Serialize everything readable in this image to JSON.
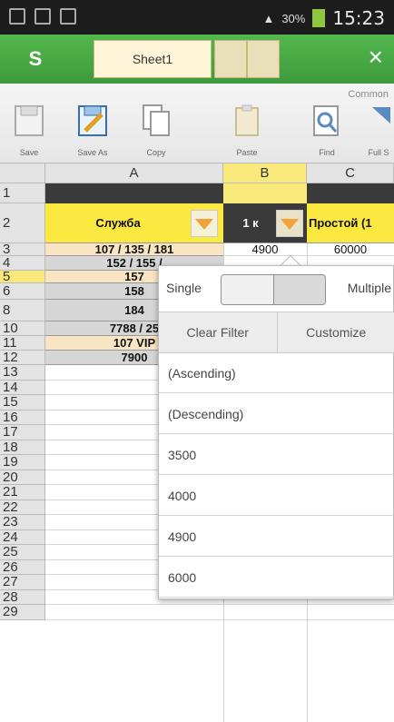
{
  "status": {
    "battery": "30%",
    "time": "15:23"
  },
  "titlebar": {
    "logo": "S",
    "sheet_tab": "Sheet1",
    "close": "×"
  },
  "toolbar": {
    "group": "Common",
    "tools": [
      {
        "label": "Save",
        "icon": "save-icon"
      },
      {
        "label": "Save As",
        "icon": "save-as-icon"
      },
      {
        "label": "Copy",
        "icon": "copy-icon"
      },
      {
        "label": "Paste",
        "icon": "paste-icon"
      },
      {
        "label": "Find",
        "icon": "find-icon"
      },
      {
        "label": "Full S",
        "icon": "full-screen-icon"
      }
    ]
  },
  "grid": {
    "columns": [
      "A",
      "B",
      "C"
    ],
    "rows": [
      "1",
      "2",
      "3",
      "4",
      "5",
      "6",
      "8",
      "10",
      "11",
      "12",
      "13",
      "14",
      "15",
      "16",
      "17",
      "18",
      "19",
      "20",
      "21",
      "22",
      "23",
      "24",
      "25",
      "26",
      "27",
      "28",
      "29"
    ],
    "header_row": {
      "a": "Служба",
      "b": "1 к",
      "c": "Простой (1"
    },
    "cells_a": [
      "107 / 135 / 181",
      "152 / 155 /",
      "157",
      "158",
      "184",
      "7788 / 25",
      "107 VIP",
      "7900"
    ],
    "cells_b": [
      "4900",
      "",
      "",
      "",
      "",
      "",
      "",
      ""
    ],
    "cells_c": [
      "60000"
    ]
  },
  "filter": {
    "single_label": "Single",
    "multiple_label": "Multiple",
    "clear_label": "Clear Filter",
    "customize_label": "Customize",
    "options": [
      "(Ascending)",
      "(Descending)",
      "3500",
      "4000",
      "4900",
      "6000"
    ]
  }
}
